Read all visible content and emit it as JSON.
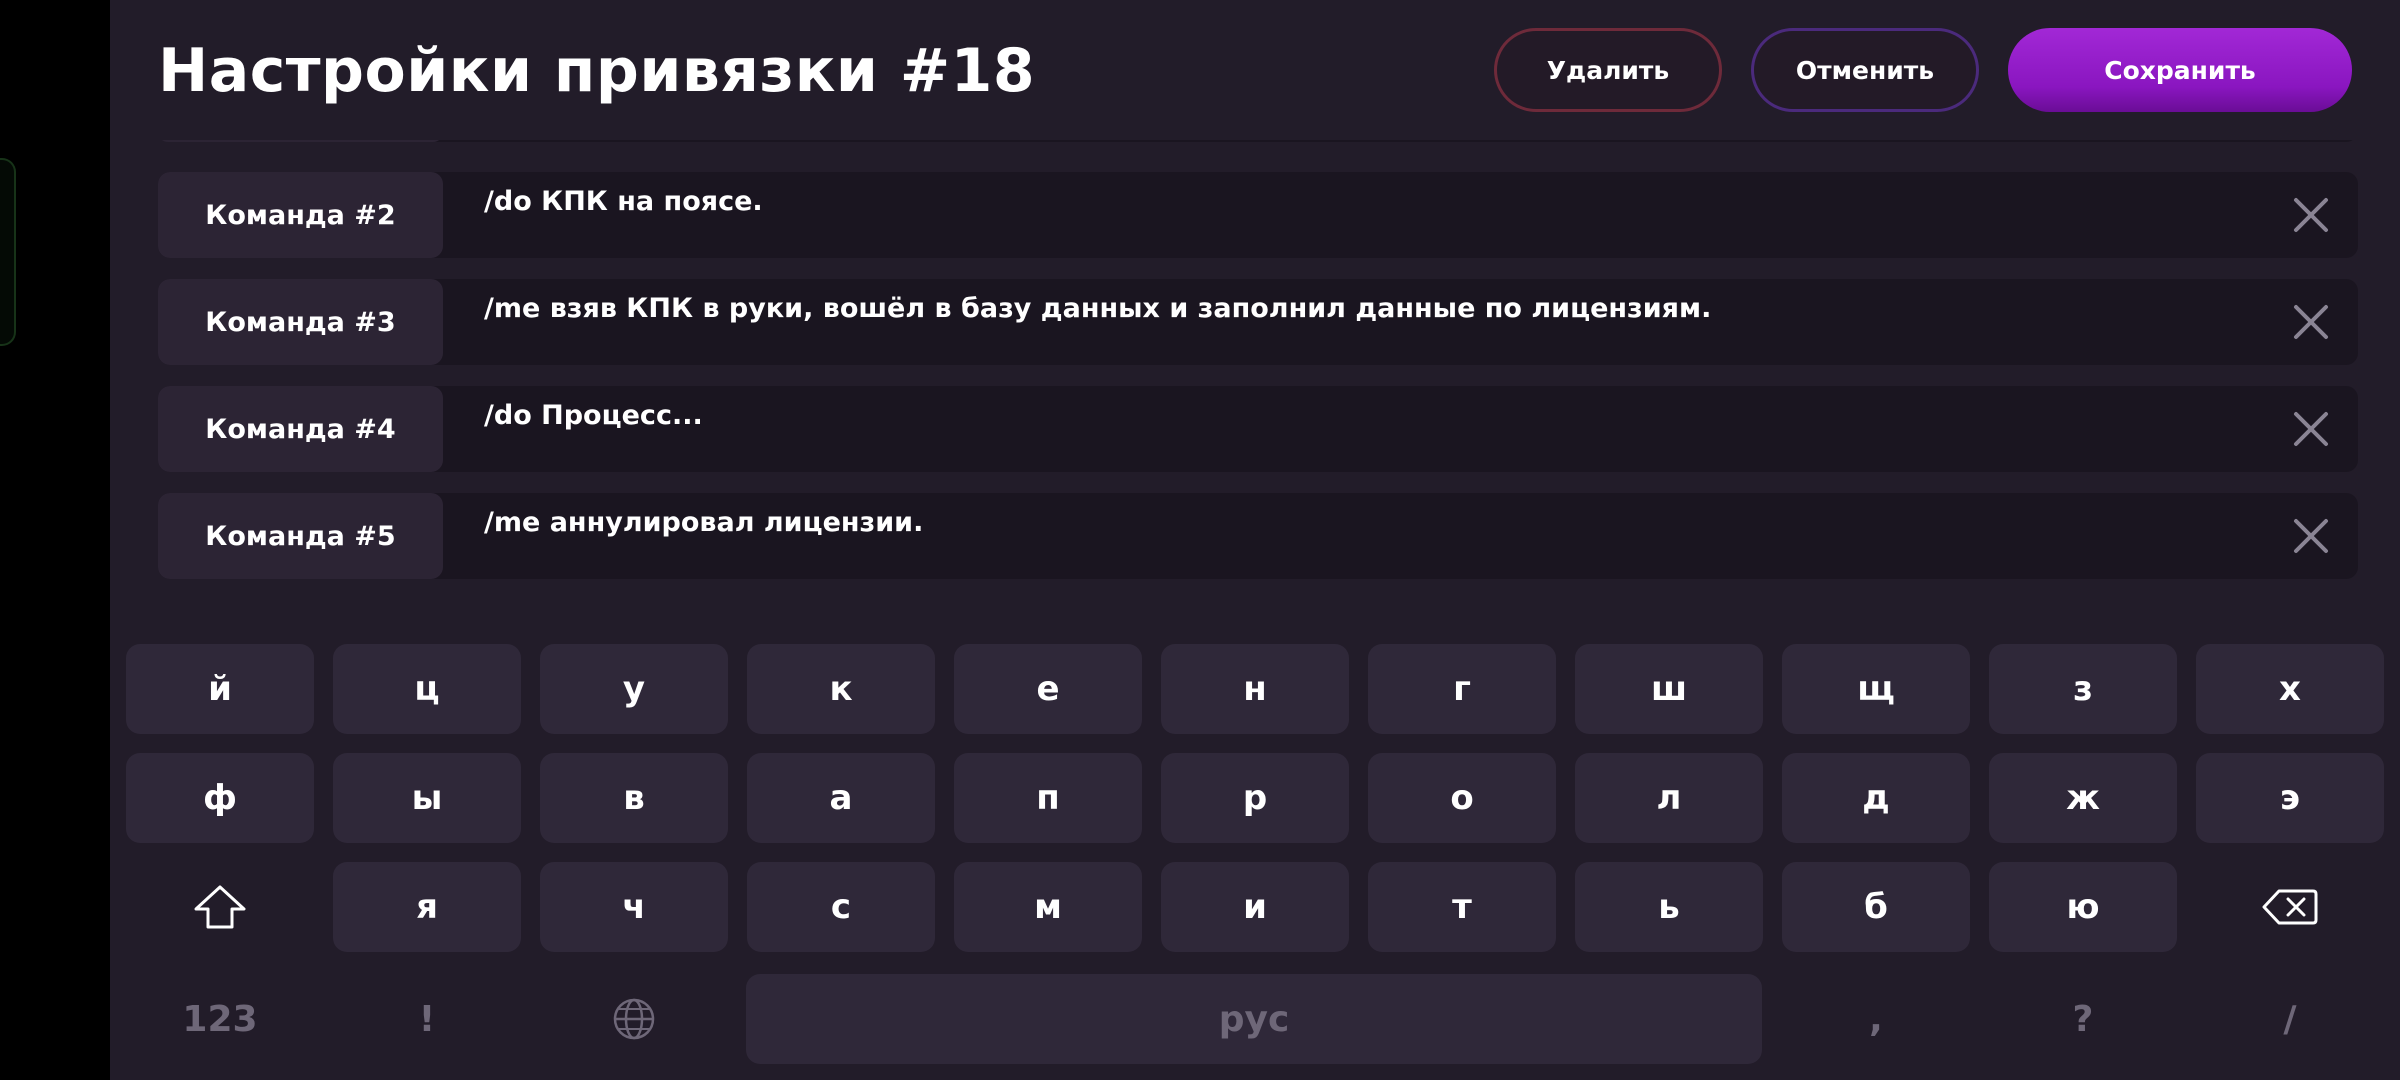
{
  "header": {
    "title": "Настройки привязки #18",
    "delete_label": "Удалить",
    "cancel_label": "Отменить",
    "save_label": "Сохранить"
  },
  "commands": [
    {
      "label": "Команда #2",
      "text": "/do КПК на поясе."
    },
    {
      "label": "Команда #3",
      "text": "/me взяв КПК в руки, вошёл в базу данных и заполнил данные по лицензиям."
    },
    {
      "label": "Команда #4",
      "text": "/do Процесс..."
    },
    {
      "label": "Команда #5",
      "text": "/me аннулировал лицензии."
    }
  ],
  "keyboard": {
    "row1": [
      "й",
      "ц",
      "у",
      "к",
      "е",
      "н",
      "г",
      "ш",
      "щ",
      "з",
      "х"
    ],
    "row2": [
      "ф",
      "ы",
      "в",
      "а",
      "п",
      "р",
      "о",
      "л",
      "д",
      "ж",
      "э"
    ],
    "row3": [
      "я",
      "ч",
      "с",
      "м",
      "и",
      "т",
      "ь",
      "б",
      "ю"
    ],
    "numbers_label": "123",
    "exclaim_label": "!",
    "space_label": "рус",
    "comma_label": ",",
    "question_label": "?",
    "slash_label": "/"
  },
  "icons": {
    "remove": "close-icon",
    "shift": "shift-icon",
    "backspace": "backspace-icon",
    "language": "globe-icon"
  },
  "colors": {
    "background": "#221c29",
    "row_background": "#1a1520",
    "label_background": "#2c2434",
    "key_background": "#2f2839",
    "save_accent": "#9a1fd0",
    "delete_border": "#6e2a3a",
    "cancel_border": "#4b2a7c"
  }
}
